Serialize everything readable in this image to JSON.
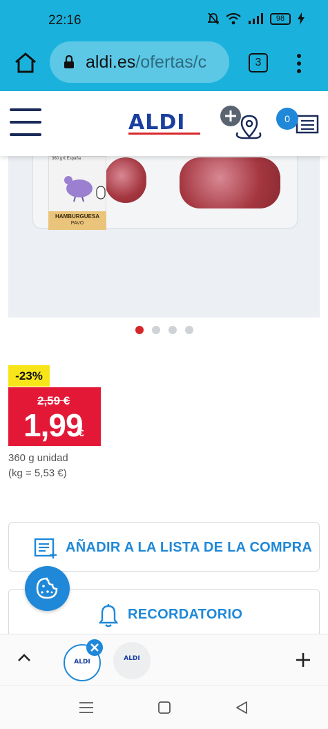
{
  "status_bar": {
    "time": "22:16",
    "battery": "98"
  },
  "browser": {
    "url_domain": "aldi.es",
    "url_path": "/ofertas/c",
    "tab_count": "3"
  },
  "site_header": {
    "logo": "ALDI",
    "list_count": "0"
  },
  "carousel": {
    "slide_count": 4,
    "active_index": 0,
    "label_top": "360 g €   España",
    "label_title": "HAMBURGUESA",
    "label_sub": "PAVO"
  },
  "price": {
    "discount": "-23%",
    "old_price": "2,59 €",
    "new_price": "1,99",
    "currency": "€",
    "unit": "360 g unidad",
    "per_kg": "(kg = 5,53 €)"
  },
  "actions": {
    "add_to_list": "AÑADIR A LA LISTA DE LA COMPRA",
    "reminder": "RECORDATORIO"
  },
  "tab_bar": {
    "tab_label": "ALDI"
  },
  "colors": {
    "brand_blue": "#1f88d8",
    "aldi_navy": "#1a3fa0",
    "price_red": "#e31837",
    "badge_yellow": "#f7e51a",
    "chrome_cyan": "#1ab2dc"
  }
}
